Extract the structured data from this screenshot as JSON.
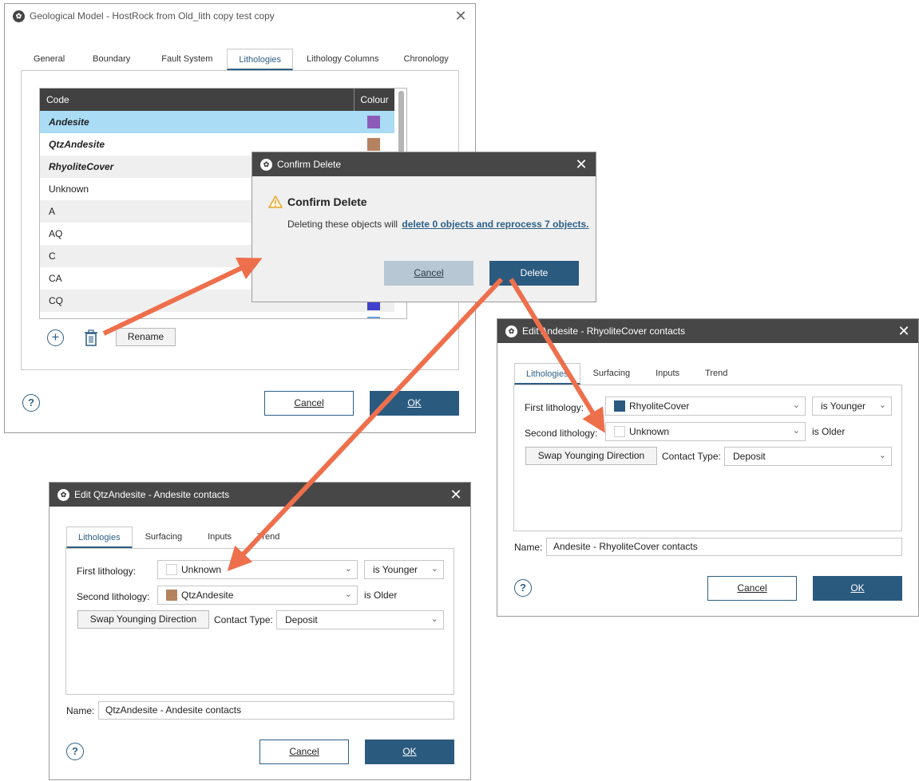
{
  "main_window": {
    "title": "Geological Model - HostRock from Old_lith copy test copy",
    "tabs": [
      "General",
      "Boundary",
      "Fault System",
      "Lithologies",
      "Lithology Columns",
      "Chronology"
    ],
    "active_tab": "Lithologies",
    "table": {
      "headers": {
        "code": "Code",
        "colour": "Colour"
      },
      "rows": [
        {
          "code": "Andesite",
          "color": "#8b5bb7",
          "style": "bold-italic",
          "selected": true
        },
        {
          "code": "QtzAndesite",
          "color": "#b5825f",
          "style": "bold-italic"
        },
        {
          "code": "RhyoliteCover",
          "color": "",
          "style": "bold-italic"
        },
        {
          "code": "Unknown",
          "color": ""
        },
        {
          "code": "A",
          "color": ""
        },
        {
          "code": "AQ",
          "color": ""
        },
        {
          "code": "C",
          "color": ""
        },
        {
          "code": "CA",
          "color": ""
        },
        {
          "code": "CQ",
          "color": "#4040cc"
        }
      ]
    },
    "rename_label": "Rename",
    "cancel_label": "Cancel",
    "ok_label": "OK",
    "help_label": "?"
  },
  "confirm_dialog": {
    "title": "Confirm Delete",
    "heading": "Confirm Delete",
    "message_prefix": "Deleting these objects will",
    "message_link": "delete 0 objects and reprocess 7 objects.",
    "cancel_label": "Cancel",
    "delete_label": "Delete"
  },
  "edit_andesite": {
    "title": "Edit Andesite - RhyoliteCover contacts",
    "tabs": [
      "Lithologies",
      "Surfacing",
      "Inputs",
      "Trend"
    ],
    "first_label": "First lithology:",
    "first_value": "RhyoliteCover",
    "first_color": "#2b5a7f",
    "younger_value": "is Younger",
    "second_label": "Second lithology:",
    "second_value": "Unknown",
    "second_color": "#ffffff",
    "older_text": "is Older",
    "swap_label": "Swap Younging Direction",
    "contact_label": "Contact Type:",
    "contact_value": "Deposit",
    "name_label": "Name:",
    "name_value": "Andesite - RhyoliteCover contacts",
    "cancel_label": "Cancel",
    "ok_label": "OK",
    "help_label": "?"
  },
  "edit_qtz": {
    "title": "Edit QtzAndesite - Andesite contacts",
    "tabs": [
      "Lithologies",
      "Surfacing",
      "Inputs",
      "Trend"
    ],
    "first_label": "First lithology:",
    "first_value": "Unknown",
    "first_color": "#ffffff",
    "younger_value": "is Younger",
    "second_label": "Second lithology:",
    "second_value": "QtzAndesite",
    "second_color": "#b5825f",
    "older_text": "is Older",
    "swap_label": "Swap Younging Direction",
    "contact_label": "Contact Type:",
    "contact_value": "Deposit",
    "name_label": "Name:",
    "name_value": "QtzAndesite - Andesite contacts",
    "cancel_label": "Cancel",
    "ok_label": "OK",
    "help_label": "?"
  },
  "colors": {
    "accent": "#2b5a7f",
    "arrow": "#ee6f4c",
    "header": "#414141",
    "selection": "#aadcf5"
  }
}
